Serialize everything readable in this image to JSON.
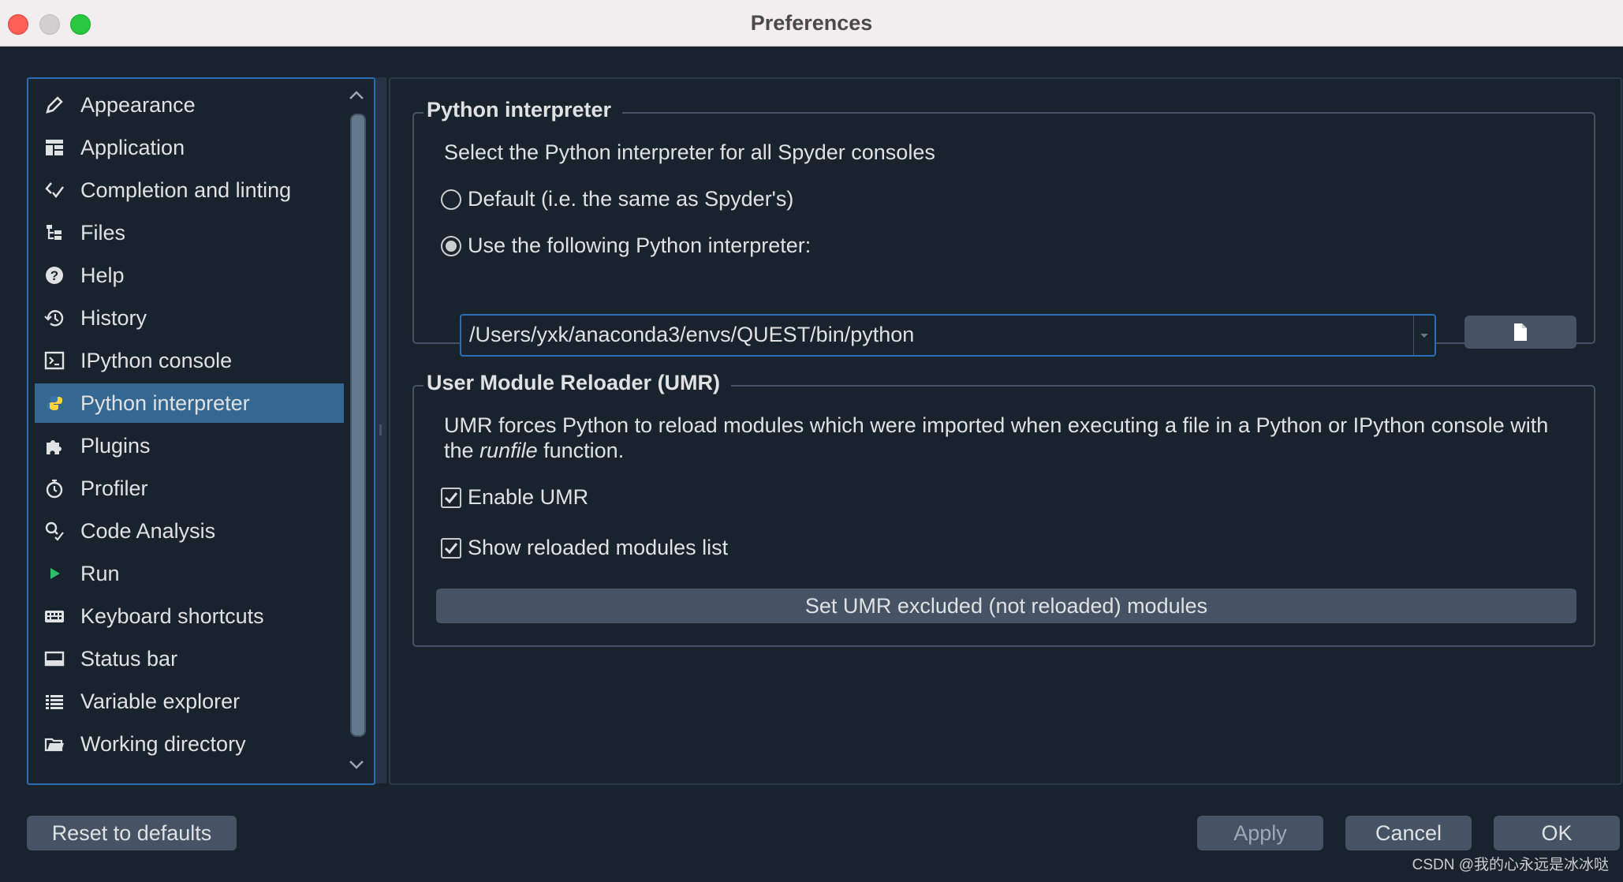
{
  "window": {
    "title": "Preferences"
  },
  "sidebar": {
    "items": [
      {
        "label": "Appearance",
        "icon": "pen-icon"
      },
      {
        "label": "Application",
        "icon": "layout-icon"
      },
      {
        "label": "Completion and linting",
        "icon": "code-check-icon"
      },
      {
        "label": "Files",
        "icon": "file-tree-icon"
      },
      {
        "label": "Help",
        "icon": "help-icon"
      },
      {
        "label": "History",
        "icon": "history-icon"
      },
      {
        "label": "IPython console",
        "icon": "terminal-icon"
      },
      {
        "label": "Python interpreter",
        "icon": "python-icon",
        "selected": true
      },
      {
        "label": "Plugins",
        "icon": "puzzle-icon"
      },
      {
        "label": "Profiler",
        "icon": "stopwatch-icon"
      },
      {
        "label": "Code Analysis",
        "icon": "code-analysis-icon"
      },
      {
        "label": "Run",
        "icon": "play-icon"
      },
      {
        "label": "Keyboard shortcuts",
        "icon": "keyboard-icon"
      },
      {
        "label": "Status bar",
        "icon": "status-bar-icon"
      },
      {
        "label": "Variable explorer",
        "icon": "list-icon"
      },
      {
        "label": "Working directory",
        "icon": "folder-icon"
      }
    ]
  },
  "interpreter": {
    "group_title": "Python interpreter",
    "description": "Select the Python interpreter for all Spyder consoles",
    "option_default": "Default (i.e. the same as Spyder's)",
    "option_custom": "Use the following Python interpreter:",
    "selected_option": "custom",
    "path": "/Users/yxk/anaconda3/envs/QUEST/bin/python"
  },
  "umr": {
    "group_title": "User Module Reloader (UMR)",
    "description_line1": "UMR forces Python to reload modules which were imported when executing a file in a Python or IPython console with",
    "description_the": "the",
    "description_runfile": "runfile",
    "description_function": "function.",
    "enable_label": "Enable UMR",
    "enable_checked": true,
    "show_list_label": "Show reloaded modules list",
    "show_list_checked": true,
    "excluded_button": "Set UMR excluded (not reloaded) modules"
  },
  "footer": {
    "reset": "Reset to defaults",
    "apply": "Apply",
    "cancel": "Cancel",
    "ok": "OK"
  },
  "watermark": "CSDN @我的心永远是冰冰哒",
  "colors": {
    "background": "#19232d",
    "selection": "#346792",
    "accent_border": "#2d6bb5",
    "button": "#455364"
  }
}
